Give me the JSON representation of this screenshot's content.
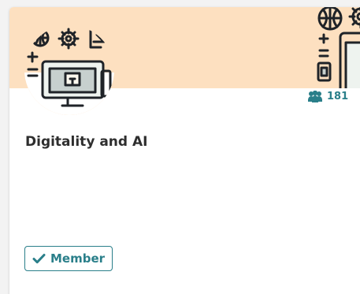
{
  "group": {
    "name": "Digitality and AI",
    "member_count": "181",
    "membership_label": "Member"
  },
  "icons": {
    "avatar": "computer-gear-globe-icon",
    "members": "users-icon",
    "membership": "check-icon"
  },
  "colors": {
    "banner": "#fde0c0",
    "accent": "#2a7f8a",
    "title": "#2e2e2e",
    "background": "#f3f3f3"
  }
}
